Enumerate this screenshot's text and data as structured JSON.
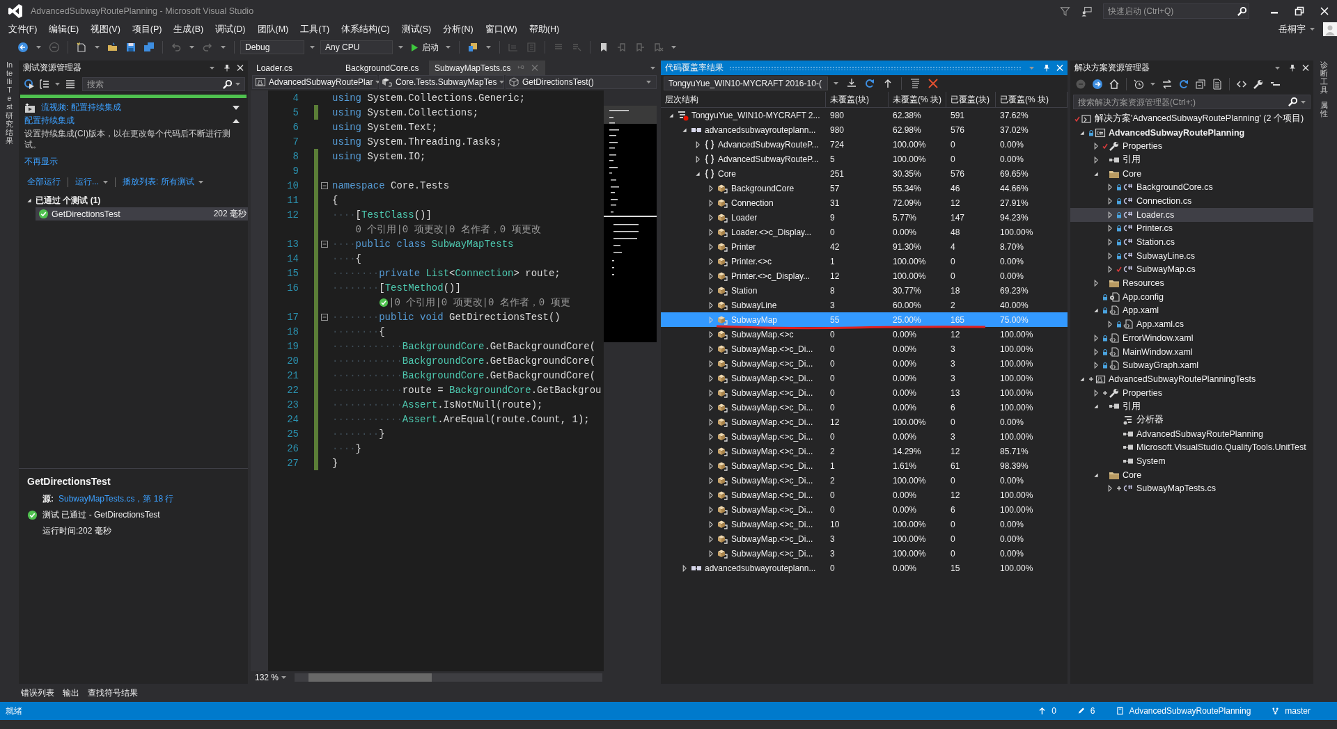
{
  "window": {
    "title": "AdvancedSubwayRoutePlanning - Microsoft Visual Studio",
    "quick_launch": {
      "placeholder": "快速启动 (Ctrl+Q)"
    },
    "user": "岳桐宇"
  },
  "menu": [
    "文件(F)",
    "编辑(E)",
    "视图(V)",
    "项目(P)",
    "生成(B)",
    "调试(D)",
    "团队(M)",
    "工具(T)",
    "体系结构(C)",
    "测试(S)",
    "分析(N)",
    "窗口(W)",
    "帮助(H)"
  ],
  "toolbar": {
    "configuration": "Debug",
    "platform": "Any CPU",
    "start": "启动"
  },
  "side_tabs_left": [
    "IntelliTest 研究结果"
  ],
  "side_tabs_right": [
    "诊断工具",
    "属性"
  ],
  "test_explorer": {
    "title": "测试资源管理器",
    "search": {
      "placeholder": "搜索"
    },
    "passed": true,
    "notice": {
      "video_link": "流视频: 配置持续集成",
      "heading": "配置持续集成",
      "text": "设置持续集成(CI)版本，以在更改每个代码后不断进行测试。",
      "dismiss": "不再显示"
    },
    "actions": [
      {
        "label": "全部运行",
        "dropdown": false
      },
      {
        "label": "运行...",
        "dropdown": true
      },
      {
        "label": "播放列表: 所有测试",
        "dropdown": true
      }
    ],
    "groups": [
      {
        "label": "已通过 个测试 (1)",
        "expanded": true,
        "tests": [
          {
            "name": "GetDirectionsTest",
            "duration": "202 毫秒",
            "passed": true,
            "selected": true
          }
        ]
      }
    ],
    "details": {
      "title": "GetDirectionsTest",
      "source_label": "源:",
      "source_link": "SubwayMapTests.cs，第 18 行",
      "result": "测试 已通过 - GetDirectionsTest",
      "passed": true,
      "elapsed": "运行时间:202 毫秒"
    }
  },
  "editor": {
    "tabs": [
      {
        "label": "Loader.cs",
        "selected": false
      },
      {
        "label": "BackgroundCore.cs",
        "selected": false
      },
      {
        "label": "SubwayMapTests.cs",
        "selected": true
      }
    ],
    "navigation": [
      "AdvancedSubwayRoutePlar",
      "Core.Tests.SubwayMapTes",
      "GetDirectionsTest()"
    ],
    "lines": [
      {
        "kind": "code",
        "number": "4",
        "changed": false,
        "fold": false,
        "tokens": [
          {
            "kind": "keyword",
            "text": "using"
          },
          {
            "kind": "text",
            "text": " System.Collections.Generic;"
          }
        ]
      },
      {
        "kind": "code",
        "number": "5",
        "changed": true,
        "fold": false,
        "tokens": [
          {
            "kind": "keyword",
            "text": "using"
          },
          {
            "kind": "text",
            "text": " System.Collections;"
          }
        ]
      },
      {
        "kind": "code",
        "number": "6",
        "changed": false,
        "fold": false,
        "tokens": [
          {
            "kind": "keyword",
            "text": "using"
          },
          {
            "kind": "text",
            "text": " System.Text;"
          }
        ]
      },
      {
        "kind": "code",
        "number": "7",
        "changed": false,
        "fold": false,
        "tokens": [
          {
            "kind": "keyword",
            "text": "using"
          },
          {
            "kind": "text",
            "text": " System.Threading.Tasks;"
          }
        ]
      },
      {
        "kind": "code",
        "number": "8",
        "changed": true,
        "fold": false,
        "tokens": [
          {
            "kind": "keyword",
            "text": "using"
          },
          {
            "kind": "text",
            "text": " System.IO;"
          }
        ]
      },
      {
        "kind": "code",
        "number": "9",
        "changed": true,
        "fold": false
      },
      {
        "kind": "code",
        "number": "10",
        "changed": true,
        "fold": true,
        "tokens": [
          {
            "kind": "keyword",
            "text": "namespace"
          },
          {
            "kind": "text",
            "text": " Core.Tests"
          }
        ]
      },
      {
        "kind": "code",
        "number": "11",
        "changed": true,
        "fold": false,
        "tokens": [
          {
            "kind": "text",
            "text": "{"
          }
        ]
      },
      {
        "kind": "code",
        "number": "12",
        "changed": true,
        "fold": false,
        "tokens": [
          {
            "kind": "whitespace",
            "text": "····"
          },
          {
            "kind": "text",
            "text": "["
          },
          {
            "kind": "type",
            "text": "TestClass"
          },
          {
            "kind": "text",
            "text": "()]"
          }
        ]
      },
      {
        "kind": "lens",
        "changed": true,
        "passed": false,
        "text": "0 个引用|0 项更改|0 名作者，0 项更改"
      },
      {
        "kind": "code",
        "number": "13",
        "changed": true,
        "fold": true,
        "tokens": [
          {
            "kind": "whitespace",
            "text": "····"
          },
          {
            "kind": "keyword",
            "text": "public"
          },
          {
            "kind": "keyword",
            "text": " class"
          },
          {
            "kind": "type",
            "text": " SubwayMapTests"
          }
        ]
      },
      {
        "kind": "code",
        "number": "14",
        "changed": true,
        "fold": false,
        "tokens": [
          {
            "kind": "whitespace",
            "text": "····"
          },
          {
            "kind": "text",
            "text": "{"
          }
        ]
      },
      {
        "kind": "code",
        "number": "15",
        "changed": true,
        "fold": false,
        "tokens": [
          {
            "kind": "whitespace",
            "text": "········"
          },
          {
            "kind": "keyword",
            "text": "private"
          },
          {
            "kind": "type",
            "text": " List"
          },
          {
            "kind": "text",
            "text": "<"
          },
          {
            "kind": "type",
            "text": "Connection"
          },
          {
            "kind": "text",
            "text": "> route;"
          }
        ]
      },
      {
        "kind": "code",
        "number": "16",
        "changed": true,
        "fold": false,
        "tokens": [
          {
            "kind": "whitespace",
            "text": "········"
          },
          {
            "kind": "text",
            "text": "["
          },
          {
            "kind": "type",
            "text": "TestMethod"
          },
          {
            "kind": "text",
            "text": "()]"
          }
        ]
      },
      {
        "kind": "lens",
        "changed": true,
        "passed": true,
        "text": "|0 个引用|0 项更改|0 名作者，0 项更"
      },
      {
        "kind": "code",
        "number": "17",
        "changed": true,
        "fold": true,
        "tokens": [
          {
            "kind": "whitespace",
            "text": "········"
          },
          {
            "kind": "keyword",
            "text": "public"
          },
          {
            "kind": "keyword",
            "text": " void"
          },
          {
            "kind": "text",
            "text": " GetDirectionsTest()"
          }
        ]
      },
      {
        "kind": "code",
        "number": "18",
        "changed": true,
        "fold": false,
        "tokens": [
          {
            "kind": "whitespace",
            "text": "········"
          },
          {
            "kind": "text",
            "text": "{"
          }
        ]
      },
      {
        "kind": "code",
        "number": "19",
        "changed": true,
        "fold": false,
        "tokens": [
          {
            "kind": "whitespace",
            "text": "············"
          },
          {
            "kind": "type",
            "text": "BackgroundCore"
          },
          {
            "kind": "text",
            "text": ".GetBackgroundCore("
          }
        ]
      },
      {
        "kind": "code",
        "number": "20",
        "changed": true,
        "fold": false,
        "tokens": [
          {
            "kind": "whitespace",
            "text": "············"
          },
          {
            "kind": "type",
            "text": "BackgroundCore"
          },
          {
            "kind": "text",
            "text": ".GetBackgroundCore("
          }
        ]
      },
      {
        "kind": "code",
        "number": "21",
        "changed": true,
        "fold": false,
        "tokens": [
          {
            "kind": "whitespace",
            "text": "············"
          },
          {
            "kind": "type",
            "text": "BackgroundCore"
          },
          {
            "kind": "text",
            "text": ".GetBackgroundCore("
          }
        ]
      },
      {
        "kind": "code",
        "number": "22",
        "changed": true,
        "fold": false,
        "tokens": [
          {
            "kind": "whitespace",
            "text": "············"
          },
          {
            "kind": "text",
            "text": "route = "
          },
          {
            "kind": "type",
            "text": "BackgroundCore"
          },
          {
            "kind": "text",
            "text": ".GetBackgrou"
          }
        ]
      },
      {
        "kind": "code",
        "number": "23",
        "changed": true,
        "fold": false,
        "tokens": [
          {
            "kind": "whitespace",
            "text": "············"
          },
          {
            "kind": "type",
            "text": "Assert"
          },
          {
            "kind": "text",
            "text": ".IsNotNull(route);"
          }
        ]
      },
      {
        "kind": "code",
        "number": "24",
        "changed": true,
        "fold": false,
        "tokens": [
          {
            "kind": "whitespace",
            "text": "············"
          },
          {
            "kind": "type",
            "text": "Assert"
          },
          {
            "kind": "text",
            "text": ".AreEqual(route.Count, 1);"
          }
        ]
      },
      {
        "kind": "code",
        "number": "25",
        "changed": true,
        "fold": false,
        "tokens": [
          {
            "kind": "whitespace",
            "text": "········"
          },
          {
            "kind": "text",
            "text": "}"
          }
        ]
      },
      {
        "kind": "code",
        "number": "26",
        "changed": true,
        "fold": false,
        "tokens": [
          {
            "kind": "whitespace",
            "text": "····"
          },
          {
            "kind": "text",
            "text": "}"
          }
        ]
      },
      {
        "kind": "code",
        "number": "27",
        "changed": true,
        "fold": false,
        "tokens": [
          {
            "kind": "text",
            "text": "}"
          }
        ]
      }
    ],
    "zoom": "132 %"
  },
  "coverage": {
    "title": "代码覆盖率结果",
    "run_selector": "TongyuYue_WIN10-MYCRAFT 2016-10-(",
    "columns": [
      "层次结构",
      "未覆盖(块)",
      "未覆盖(% 块)",
      "已覆盖(块)",
      "已覆盖(% 块)"
    ],
    "rows": [
      {
        "name": "TongyuYue_WIN10-MYCRAFT 2...",
        "kind": "run",
        "expanded": true,
        "selected": false,
        "underlined": false,
        "values": [
          "980",
          "62.38%",
          "591",
          "37.62%"
        ],
        "children": [
          {
            "name": "advancedsubwayrouteplann...",
            "kind": "assembly",
            "expanded": true,
            "selected": false,
            "underlined": false,
            "values": [
              "980",
              "62.98%",
              "576",
              "37.02%"
            ],
            "children": [
              {
                "name": "AdvancedSubwayRouteP...",
                "kind": "namespace",
                "expanded": false,
                "selected": false,
                "underlined": false,
                "values": [
                  "724",
                  "100.00%",
                  "0",
                  "0.00%"
                ]
              },
              {
                "name": "AdvancedSubwayRouteP...",
                "kind": "namespace",
                "expanded": false,
                "selected": false,
                "underlined": false,
                "values": [
                  "5",
                  "100.00%",
                  "0",
                  "0.00%"
                ]
              },
              {
                "name": "Core",
                "kind": "namespace",
                "expanded": true,
                "selected": false,
                "underlined": false,
                "values": [
                  "251",
                  "30.35%",
                  "576",
                  "69.65%"
                ],
                "children": [
                  {
                    "name": "BackgroundCore",
                    "kind": "class",
                    "expanded": false,
                    "selected": false,
                    "underlined": false,
                    "values": [
                      "57",
                      "55.34%",
                      "46",
                      "44.66%"
                    ]
                  },
                  {
                    "name": "Connection",
                    "kind": "class",
                    "expanded": false,
                    "selected": false,
                    "underlined": false,
                    "values": [
                      "31",
                      "72.09%",
                      "12",
                      "27.91%"
                    ]
                  },
                  {
                    "name": "Loader",
                    "kind": "class",
                    "expanded": false,
                    "selected": false,
                    "underlined": false,
                    "values": [
                      "9",
                      "5.77%",
                      "147",
                      "94.23%"
                    ]
                  },
                  {
                    "name": "Loader.<>c_Display...",
                    "kind": "class",
                    "expanded": false,
                    "selected": false,
                    "underlined": false,
                    "values": [
                      "0",
                      "0.00%",
                      "48",
                      "100.00%"
                    ]
                  },
                  {
                    "name": "Printer",
                    "kind": "class",
                    "expanded": false,
                    "selected": false,
                    "underlined": false,
                    "values": [
                      "42",
                      "91.30%",
                      "4",
                      "8.70%"
                    ]
                  },
                  {
                    "name": "Printer.<>c",
                    "kind": "class",
                    "expanded": false,
                    "selected": false,
                    "underlined": false,
                    "values": [
                      "1",
                      "100.00%",
                      "0",
                      "0.00%"
                    ]
                  },
                  {
                    "name": "Printer.<>c_Display...",
                    "kind": "class",
                    "expanded": false,
                    "selected": false,
                    "underlined": false,
                    "values": [
                      "12",
                      "100.00%",
                      "0",
                      "0.00%"
                    ]
                  },
                  {
                    "name": "Station",
                    "kind": "class",
                    "expanded": false,
                    "selected": false,
                    "underlined": false,
                    "values": [
                      "8",
                      "30.77%",
                      "18",
                      "69.23%"
                    ]
                  },
                  {
                    "name": "SubwayLine",
                    "kind": "class",
                    "expanded": false,
                    "selected": false,
                    "underlined": false,
                    "values": [
                      "3",
                      "60.00%",
                      "2",
                      "40.00%"
                    ]
                  },
                  {
                    "name": "SubwayMap",
                    "kind": "class",
                    "expanded": false,
                    "selected": true,
                    "underlined": true,
                    "values": [
                      "55",
                      "25.00%",
                      "165",
                      "75.00%"
                    ]
                  },
                  {
                    "name": "SubwayMap.<>c",
                    "kind": "class",
                    "expanded": false,
                    "selected": false,
                    "underlined": false,
                    "values": [
                      "0",
                      "0.00%",
                      "12",
                      "100.00%"
                    ]
                  },
                  {
                    "name": "SubwayMap.<>c_Di...",
                    "kind": "class",
                    "expanded": false,
                    "selected": false,
                    "underlined": false,
                    "values": [
                      "0",
                      "0.00%",
                      "3",
                      "100.00%"
                    ]
                  },
                  {
                    "name": "SubwayMap.<>c_Di...",
                    "kind": "class",
                    "expanded": false,
                    "selected": false,
                    "underlined": false,
                    "values": [
                      "0",
                      "0.00%",
                      "3",
                      "100.00%"
                    ]
                  },
                  {
                    "name": "SubwayMap.<>c_Di...",
                    "kind": "class",
                    "expanded": false,
                    "selected": false,
                    "underlined": false,
                    "values": [
                      "0",
                      "0.00%",
                      "3",
                      "100.00%"
                    ]
                  },
                  {
                    "name": "SubwayMap.<>c_Di...",
                    "kind": "class",
                    "expanded": false,
                    "selected": false,
                    "underlined": false,
                    "values": [
                      "0",
                      "0.00%",
                      "13",
                      "100.00%"
                    ]
                  },
                  {
                    "name": "SubwayMap.<>c_Di...",
                    "kind": "class",
                    "expanded": false,
                    "selected": false,
                    "underlined": false,
                    "values": [
                      "0",
                      "0.00%",
                      "6",
                      "100.00%"
                    ]
                  },
                  {
                    "name": "SubwayMap.<>c_Di...",
                    "kind": "class",
                    "expanded": false,
                    "selected": false,
                    "underlined": false,
                    "values": [
                      "12",
                      "100.00%",
                      "0",
                      "0.00%"
                    ]
                  },
                  {
                    "name": "SubwayMap.<>c_Di...",
                    "kind": "class",
                    "expanded": false,
                    "selected": false,
                    "underlined": false,
                    "values": [
                      "0",
                      "0.00%",
                      "3",
                      "100.00%"
                    ]
                  },
                  {
                    "name": "SubwayMap.<>c_Di...",
                    "kind": "class",
                    "expanded": false,
                    "selected": false,
                    "underlined": false,
                    "values": [
                      "2",
                      "14.29%",
                      "12",
                      "85.71%"
                    ]
                  },
                  {
                    "name": "SubwayMap.<>c_Di...",
                    "kind": "class",
                    "expanded": false,
                    "selected": false,
                    "underlined": false,
                    "values": [
                      "1",
                      "1.61%",
                      "61",
                      "98.39%"
                    ]
                  },
                  {
                    "name": "SubwayMap.<>c_Di...",
                    "kind": "class",
                    "expanded": false,
                    "selected": false,
                    "underlined": false,
                    "values": [
                      "2",
                      "100.00%",
                      "0",
                      "0.00%"
                    ]
                  },
                  {
                    "name": "SubwayMap.<>c_Di...",
                    "kind": "class",
                    "expanded": false,
                    "selected": false,
                    "underlined": false,
                    "values": [
                      "0",
                      "0.00%",
                      "12",
                      "100.00%"
                    ]
                  },
                  {
                    "name": "SubwayMap.<>c_Di...",
                    "kind": "class",
                    "expanded": false,
                    "selected": false,
                    "underlined": false,
                    "values": [
                      "0",
                      "0.00%",
                      "6",
                      "100.00%"
                    ]
                  },
                  {
                    "name": "SubwayMap.<>c_Di...",
                    "kind": "class",
                    "expanded": false,
                    "selected": false,
                    "underlined": false,
                    "values": [
                      "10",
                      "100.00%",
                      "0",
                      "0.00%"
                    ]
                  },
                  {
                    "name": "SubwayMap.<>c_Di...",
                    "kind": "class",
                    "expanded": false,
                    "selected": false,
                    "underlined": false,
                    "values": [
                      "3",
                      "100.00%",
                      "0",
                      "0.00%"
                    ]
                  },
                  {
                    "name": "SubwayMap.<>c_Di...",
                    "kind": "class",
                    "expanded": false,
                    "selected": false,
                    "underlined": false,
                    "values": [
                      "3",
                      "100.00%",
                      "0",
                      "0.00%"
                    ]
                  }
                ]
              }
            ]
          },
          {
            "name": "advancedsubwayrouteplann...",
            "kind": "assembly",
            "expanded": false,
            "selected": false,
            "underlined": false,
            "values": [
              "0",
              "0.00%",
              "15",
              "100.00%"
            ]
          }
        ]
      }
    ]
  },
  "solution": {
    "title": "解决方案资源管理器",
    "search": {
      "placeholder": "搜索解决方案资源管理器(Ctrl+;)"
    },
    "tree": [
      {
        "name": "解决方案'AdvancedSubwayRoutePlanning' (2 个项目)",
        "kind": "solution",
        "source_control": {
          "kind": "check"
        },
        "selected": false,
        "children": [
          {
            "name": "AdvancedSubwayRoutePlanning",
            "kind": "startup-project",
            "source_control": {
              "kind": "lock"
            },
            "expanded": true,
            "selected": false,
            "children": [
              {
                "name": "Properties",
                "kind": "properties",
                "source_control": {
                  "kind": "check"
                },
                "expanded": false,
                "selected": false
              },
              {
                "name": "引用",
                "kind": "references",
                "expanded": false,
                "selected": false
              },
              {
                "name": "Core",
                "kind": "folder",
                "expanded": true,
                "selected": false,
                "children": [
                  {
                    "name": "BackgroundCore.cs",
                    "kind": "cs",
                    "source_control": {
                      "kind": "lock"
                    },
                    "expanded": false,
                    "selected": false
                  },
                  {
                    "name": "Connection.cs",
                    "kind": "cs",
                    "source_control": {
                      "kind": "lock"
                    },
                    "expanded": false,
                    "selected": false
                  },
                  {
                    "name": "Loader.cs",
                    "kind": "cs",
                    "source_control": {
                      "kind": "lock"
                    },
                    "expanded": false,
                    "selected": true
                  },
                  {
                    "name": "Printer.cs",
                    "kind": "cs",
                    "source_control": {
                      "kind": "lock"
                    },
                    "expanded": false,
                    "selected": false
                  },
                  {
                    "name": "Station.cs",
                    "kind": "cs",
                    "source_control": {
                      "kind": "lock"
                    },
                    "expanded": false,
                    "selected": false
                  },
                  {
                    "name": "SubwayLine.cs",
                    "kind": "cs",
                    "source_control": {
                      "kind": "lock"
                    },
                    "expanded": false,
                    "selected": false
                  },
                  {
                    "name": "SubwayMap.cs",
                    "kind": "cs",
                    "source_control": {
                      "kind": "check"
                    },
                    "expanded": false,
                    "selected": false
                  }
                ]
              },
              {
                "name": "Resources",
                "kind": "folder",
                "expanded": false,
                "selected": false
              },
              {
                "name": "App.config",
                "kind": "config",
                "source_control": {
                  "kind": "lock"
                },
                "selected": false
              },
              {
                "name": "App.xaml",
                "kind": "xaml",
                "source_control": {
                  "kind": "lock"
                },
                "expanded": true,
                "selected": false,
                "children": [
                  {
                    "name": "App.xaml.cs",
                    "kind": "xaml-cs",
                    "source_control": {
                      "kind": "lock"
                    },
                    "expanded": false,
                    "selected": false
                  }
                ]
              },
              {
                "name": "ErrorWindow.xaml",
                "kind": "xaml",
                "source_control": {
                  "kind": "lock"
                },
                "expanded": false,
                "selected": false
              },
              {
                "name": "MainWindow.xaml",
                "kind": "xaml",
                "source_control": {
                  "kind": "lock"
                },
                "expanded": false,
                "selected": false
              },
              {
                "name": "SubwayGraph.xaml",
                "kind": "xaml",
                "source_control": {
                  "kind": "lock"
                },
                "expanded": false,
                "selected": false
              }
            ]
          },
          {
            "name": "AdvancedSubwayRoutePlanningTests",
            "kind": "test-project",
            "source_control": {
              "kind": "plus"
            },
            "expanded": true,
            "selected": false,
            "children": [
              {
                "name": "Properties",
                "kind": "properties",
                "source_control": {
                  "kind": "plus"
                },
                "expanded": false,
                "selected": false
              },
              {
                "name": "引用",
                "kind": "references",
                "expanded": true,
                "selected": false,
                "children": [
                  {
                    "name": "分析器",
                    "kind": "analyzer",
                    "selected": false
                  },
                  {
                    "name": "AdvancedSubwayRoutePlanning",
                    "kind": "reference",
                    "selected": false
                  },
                  {
                    "name": "Microsoft.VisualStudio.QualityTools.UnitTest",
                    "kind": "reference",
                    "selected": false
                  },
                  {
                    "name": "System",
                    "kind": "reference",
                    "selected": false
                  }
                ]
              },
              {
                "name": "Core",
                "kind": "folder",
                "expanded": true,
                "selected": false,
                "children": [
                  {
                    "name": "SubwayMapTests.cs",
                    "kind": "cs",
                    "source_control": {
                      "kind": "plus"
                    },
                    "expanded": false,
                    "selected": false
                  }
                ]
              }
            ]
          }
        ]
      }
    ]
  },
  "bottom_tabs": [
    "错误列表",
    "输出",
    "查找符号结果"
  ],
  "status_bar": {
    "message": "就绪",
    "pending_pushes": "0",
    "pending_changes": "6",
    "repository": "AdvancedSubwayRoutePlanning",
    "branch": "master"
  }
}
